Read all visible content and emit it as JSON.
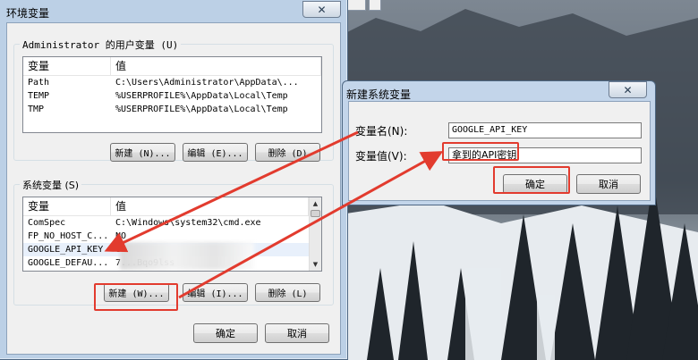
{
  "main_dialog": {
    "title": "环境变量",
    "user_group_label": "Administrator 的用户变量 (U)",
    "columns": [
      "变量",
      "值"
    ],
    "user_vars": [
      {
        "name": "Path",
        "value": "C:\\Users\\Administrator\\AppData\\..."
      },
      {
        "name": "TEMP",
        "value": "%USERPROFILE%\\AppData\\Local\\Temp"
      },
      {
        "name": "TMP",
        "value": "%USERPROFILE%\\AppData\\Local\\Temp"
      }
    ],
    "user_buttons": {
      "new": "新建 (N)...",
      "edit": "编辑 (E)...",
      "delete": "删除 (D)"
    },
    "system_group_label": "系统变量 (S)",
    "system_vars": [
      {
        "name": "ComSpec",
        "value": "C:\\Windows\\system32\\cmd.exe"
      },
      {
        "name": "FP_NO_HOST_C...",
        "value": "NO"
      },
      {
        "name": "GOOGLE_API_KEY",
        "value": "G"
      },
      {
        "name": "GOOGLE_DEFAU...",
        "value": "7...Bqo9lss"
      }
    ],
    "system_buttons": {
      "new": "新建 (W)...",
      "edit": "编辑 (I)...",
      "delete": "删除 (L)"
    },
    "ok": "确定",
    "cancel": "取消"
  },
  "new_var_dialog": {
    "title": "新建系统变量",
    "name_label": "变量名(N):",
    "name_value": "GOOGLE_API_KEY",
    "value_label": "变量值(V):",
    "value_value": "拿到的API密钥",
    "ok": "确定",
    "cancel": "取消"
  },
  "colors": {
    "annotation": "#e23b2e"
  },
  "icons": [
    "close-icon",
    "scroll-up-icon",
    "scroll-down-icon"
  ]
}
